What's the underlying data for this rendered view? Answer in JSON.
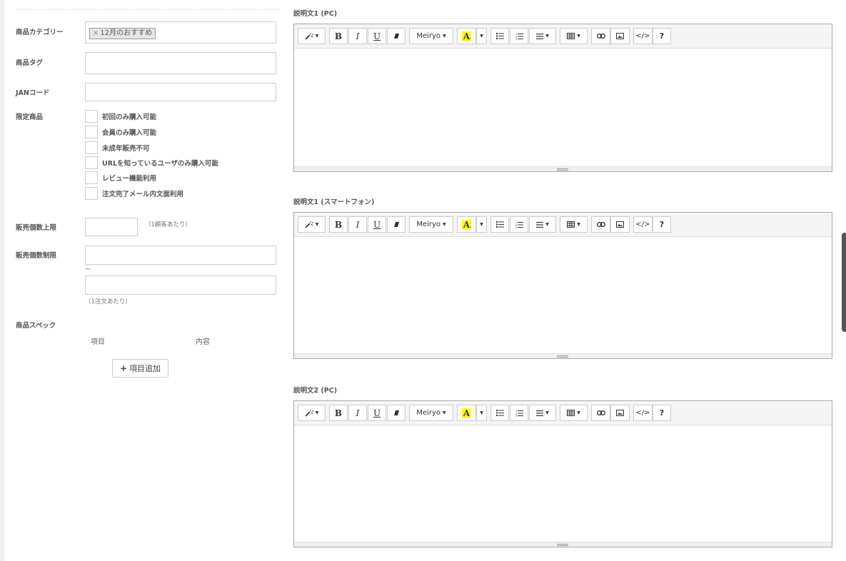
{
  "form": {
    "category_label": "商品カテゴリー",
    "category_tag": "12月のおすすめ",
    "category_tag_remove": "×",
    "tag_label": "商品タグ",
    "tag_value": "",
    "jan_label": "JANコード",
    "jan_value": "",
    "limited_label": "限定商品",
    "limited_options": [
      {
        "label": "初回のみ購入可能",
        "checked": false
      },
      {
        "label": "会員のみ購入可能",
        "checked": false
      },
      {
        "label": "未成年販売不可",
        "checked": false
      },
      {
        "label": "URLを知っているユーザのみ購入可能",
        "checked": false
      },
      {
        "label": "レビュー機能利用",
        "checked": false
      },
      {
        "label": "注文完了メール内文面利用",
        "checked": false
      }
    ],
    "max_qty_label": "販売個数上限",
    "max_qty_value": "",
    "max_qty_note": "（1顧客あたり）",
    "qty_limit_label": "販売個数制限",
    "qty_limit_min": "",
    "qty_limit_sep": "~",
    "qty_limit_max": "",
    "qty_limit_note": "（1注文あたり）",
    "spec_label": "商品スペック",
    "spec_col_item": "項目",
    "spec_col_content": "内容",
    "spec_add_button": "項目追加"
  },
  "editors": [
    {
      "title": "説明文1 (PC)",
      "content": ""
    },
    {
      "title": "説明文1 (スマートフォン)",
      "content": ""
    },
    {
      "title": "説明文2 (PC)",
      "content": ""
    }
  ],
  "toolbar": {
    "style_icon": "magic-wand-icon",
    "bold": "B",
    "italic": "I",
    "underline": "U",
    "eraser_icon": "eraser-icon",
    "font_name": "Meiryo",
    "color_letter": "A",
    "highlight_color": "#ffff00",
    "ul_icon": "unordered-list-icon",
    "ol_icon": "ordered-list-icon",
    "align_icon": "align-icon",
    "table_icon": "table-icon",
    "link_icon": "link-icon",
    "picture_icon": "picture-icon",
    "code": "</>",
    "help": "?"
  }
}
